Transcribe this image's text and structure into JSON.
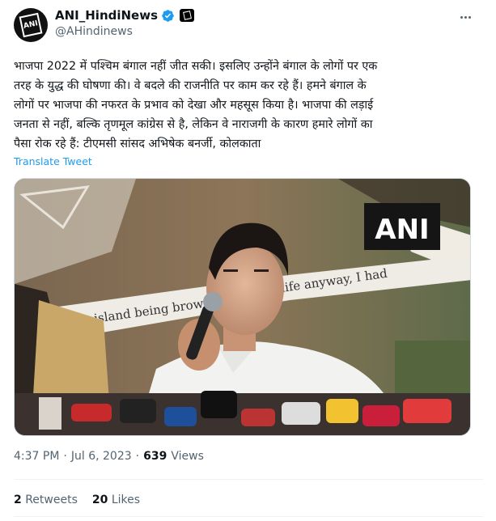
{
  "tweet": {
    "display_name": "ANI_HindiNews",
    "handle": "@AHindinews",
    "avatar_text": "ANI",
    "text_lines": [
      "भाजपा 2022 में पश्चिम बंगाल नहीं जीत सकी। इसलिए उन्होंने बंगाल के लोगों पर एक",
      "तरह के युद्ध की घोषणा की। वे बदले की राजनीति पर काम कर रहे हैं। हमने बंगाल के",
      "लोगों पर भाजपा की नफरत के प्रभाव को देखा और महसूस किया है। भाजपा की लड़ाई",
      "जनता से नहीं, बल्कि तृणमूल कांग्रेस से है, लेकिन वे नाराजगी के कारण हमारे लोगों का",
      "पैसा रोक रहे हैं: टीएमसी सांसद अभिषेक बनर्जी, कोलकाता"
    ],
    "translate_label": "Translate Tweet",
    "media": {
      "watermark": "ANI",
      "backdrop_text": "the island being brow",
      "backdrop_text_2": "life anyway, I had"
    },
    "time": "4:37 PM",
    "date": "Jul 6, 2023",
    "views_count": "639",
    "views_label": "Views",
    "retweets_count": "2",
    "retweets_label": "Retweets",
    "likes_count": "20",
    "likes_label": "Likes"
  },
  "colors": {
    "text": "#0f1419",
    "secondary": "#536471",
    "link": "#1d9bf0",
    "verified": "#1d9bf0"
  },
  "icons": [
    "verified-badge-icon",
    "affiliate-badge-icon",
    "more-options-icon"
  ]
}
